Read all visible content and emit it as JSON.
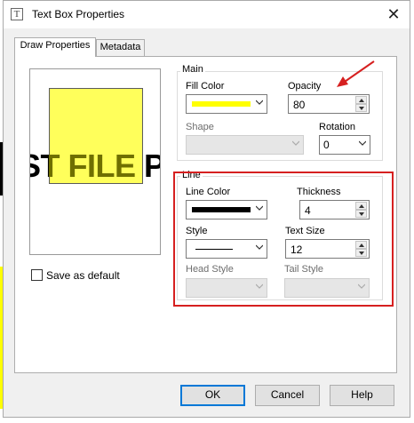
{
  "window": {
    "title": "Text Box Properties",
    "close_glyph": "✕"
  },
  "tabs": [
    {
      "label": "Draw Properties",
      "active": true
    },
    {
      "label": "Metadata",
      "active": false
    }
  ],
  "preview": {
    "text": "ST FILE P",
    "fill_color": "#ffff33"
  },
  "save_default": {
    "label": "Save as default",
    "checked": false
  },
  "main": {
    "label": "Main",
    "fill_color_label": "Fill Color",
    "fill_color": "#ffff00",
    "opacity_label": "Opacity",
    "opacity": "80",
    "shape_label": "Shape",
    "rotation_label": "Rotation",
    "rotation": "0"
  },
  "line": {
    "label": "Line",
    "line_color_label": "Line Color",
    "line_color": "#000000",
    "thickness_label": "Thickness",
    "thickness": "4",
    "style_label": "Style",
    "text_size_label": "Text Size",
    "text_size": "12",
    "head_style_label": "Head Style",
    "tail_style_label": "Tail Style"
  },
  "buttons": {
    "ok": "OK",
    "cancel": "Cancel",
    "help": "Help"
  },
  "colors": {
    "accent": "#0078d7",
    "annotation": "#d62020"
  }
}
